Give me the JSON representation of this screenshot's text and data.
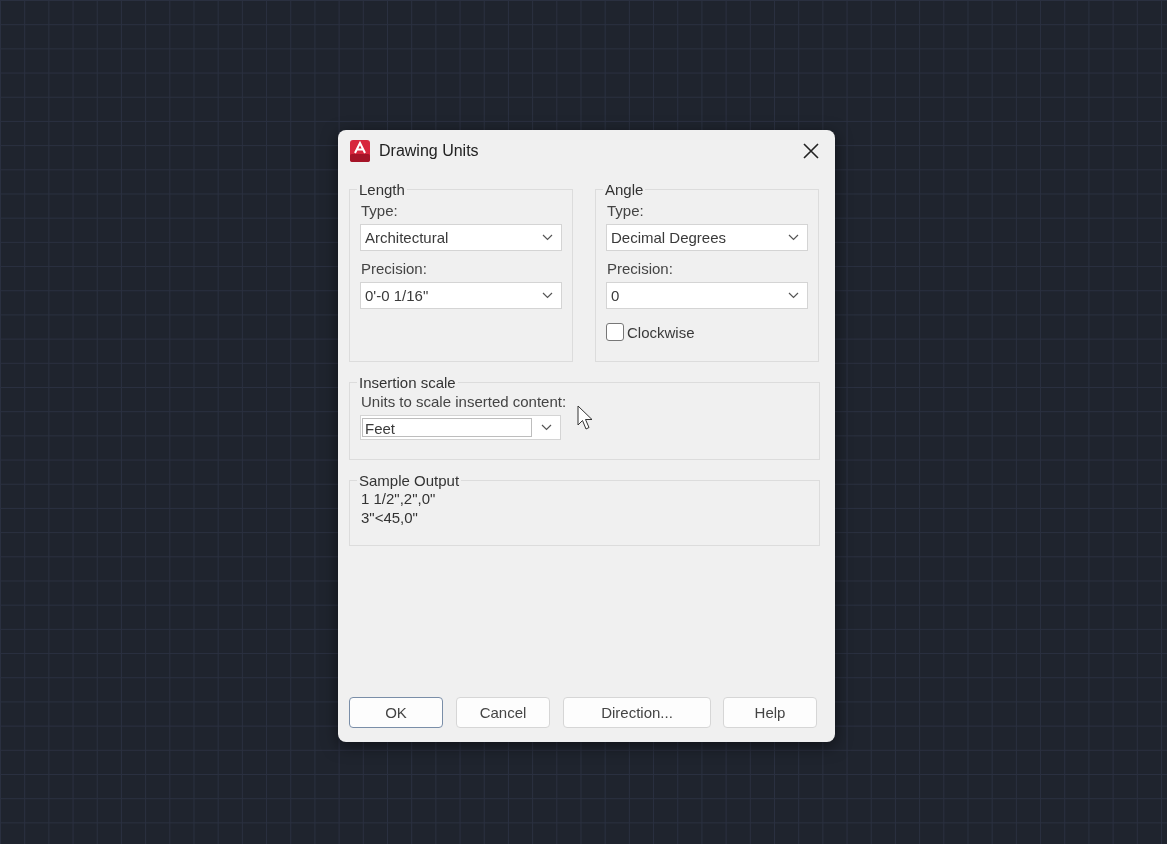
{
  "window": {
    "title": "Drawing Units"
  },
  "length": {
    "title": "Length",
    "fields": [
      {
        "label": "Type:",
        "value": "Architectural"
      },
      {
        "label": "Precision:",
        "value": "0'-0 1/16\""
      }
    ]
  },
  "angle": {
    "title": "Angle",
    "fields": [
      {
        "label": "Type:",
        "value": "Decimal Degrees"
      },
      {
        "label": "Precision:",
        "value": "0"
      }
    ],
    "checkbox": {
      "label": "Clockwise",
      "checked": false
    }
  },
  "insertion_scale": {
    "title": "Insertion scale",
    "label": "Units to scale inserted content:",
    "value": "Feet"
  },
  "sample_output": {
    "title": "Sample Output",
    "lines": [
      "1 1/2\",2\",0\"",
      "3\"<45,0\""
    ]
  },
  "buttons": [
    {
      "label": "OK",
      "default": true
    },
    {
      "label": "Cancel",
      "default": false
    },
    {
      "label": "Direction...",
      "default": false
    },
    {
      "label": "Help",
      "default": false
    }
  ]
}
